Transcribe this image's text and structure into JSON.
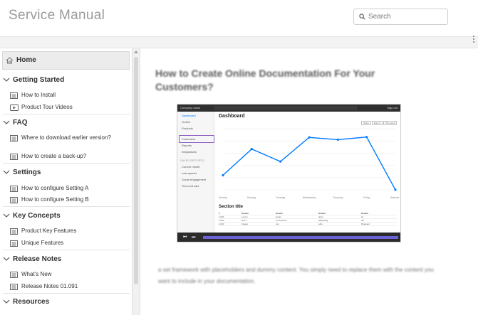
{
  "header": {
    "title": "Service Manual",
    "search_placeholder": "Search"
  },
  "sidebar": {
    "home_label": "Home",
    "sections": [
      {
        "title": "Getting Started",
        "items": [
          {
            "label": "How to Install",
            "icon": "document-icon"
          },
          {
            "label": "Product Tour Videos",
            "icon": "video-icon"
          }
        ]
      },
      {
        "title": "FAQ",
        "items": [
          {
            "label": "Where to download earlier version?",
            "icon": "document-icon"
          },
          {
            "label": "How to create a back-up?",
            "icon": "document-icon"
          }
        ]
      },
      {
        "title": "Settings",
        "items": [
          {
            "label": "How to configure Setting A",
            "icon": "document-icon"
          },
          {
            "label": "How to configure Setting B",
            "icon": "document-icon"
          }
        ]
      },
      {
        "title": "Key Concepts",
        "items": [
          {
            "label": "Product Key Features",
            "icon": "document-icon"
          },
          {
            "label": "Unique Features",
            "icon": "document-icon"
          }
        ]
      },
      {
        "title": "Release Notes",
        "items": [
          {
            "label": "What's New",
            "icon": "document-icon"
          },
          {
            "label": "Release Notes 01.091",
            "icon": "document-icon"
          }
        ]
      },
      {
        "title": "Resources",
        "items": []
      }
    ]
  },
  "article": {
    "title": "How to Create Online Documentation For Your Customers?",
    "body": "a set framework with placeholders and dummy content. You simply need to replace them with the content you want to include in your documentation."
  },
  "embedded_screenshot": {
    "brand": "Company name",
    "signout": "Sign out",
    "heading": "Dashboard",
    "buttons": [
      "Share",
      "Export",
      "This week"
    ],
    "nav": [
      "Dashboard",
      "Orders",
      "Products",
      "Customers",
      "Reports",
      "Integrations",
      "SAVED REPORTS",
      "Current month",
      "Last quarter",
      "Social engagement",
      "Year-end sale"
    ],
    "section_title": "Section title",
    "table_header": [
      "#",
      "Header",
      "Header",
      "Header",
      "Header"
    ],
    "table_rows": [
      [
        "1,001",
        "Lorem",
        "ipsum",
        "dolor",
        "sit"
      ],
      [
        "1,002",
        "amet",
        "consectetur",
        "adipiscing",
        "elit"
      ],
      [
        "1,003",
        "Integer",
        "nec",
        "odio",
        "Praesent"
      ]
    ],
    "chart_values": [
      15339,
      21345,
      18483,
      24003,
      23489,
      24092,
      12034
    ],
    "chart_days": [
      "Sunday",
      "Monday",
      "Tuesday",
      "Wednesday",
      "Thursday",
      "Friday",
      "Saturday"
    ],
    "accent_color": "#007bff",
    "progress_color": "#6c63d6"
  }
}
